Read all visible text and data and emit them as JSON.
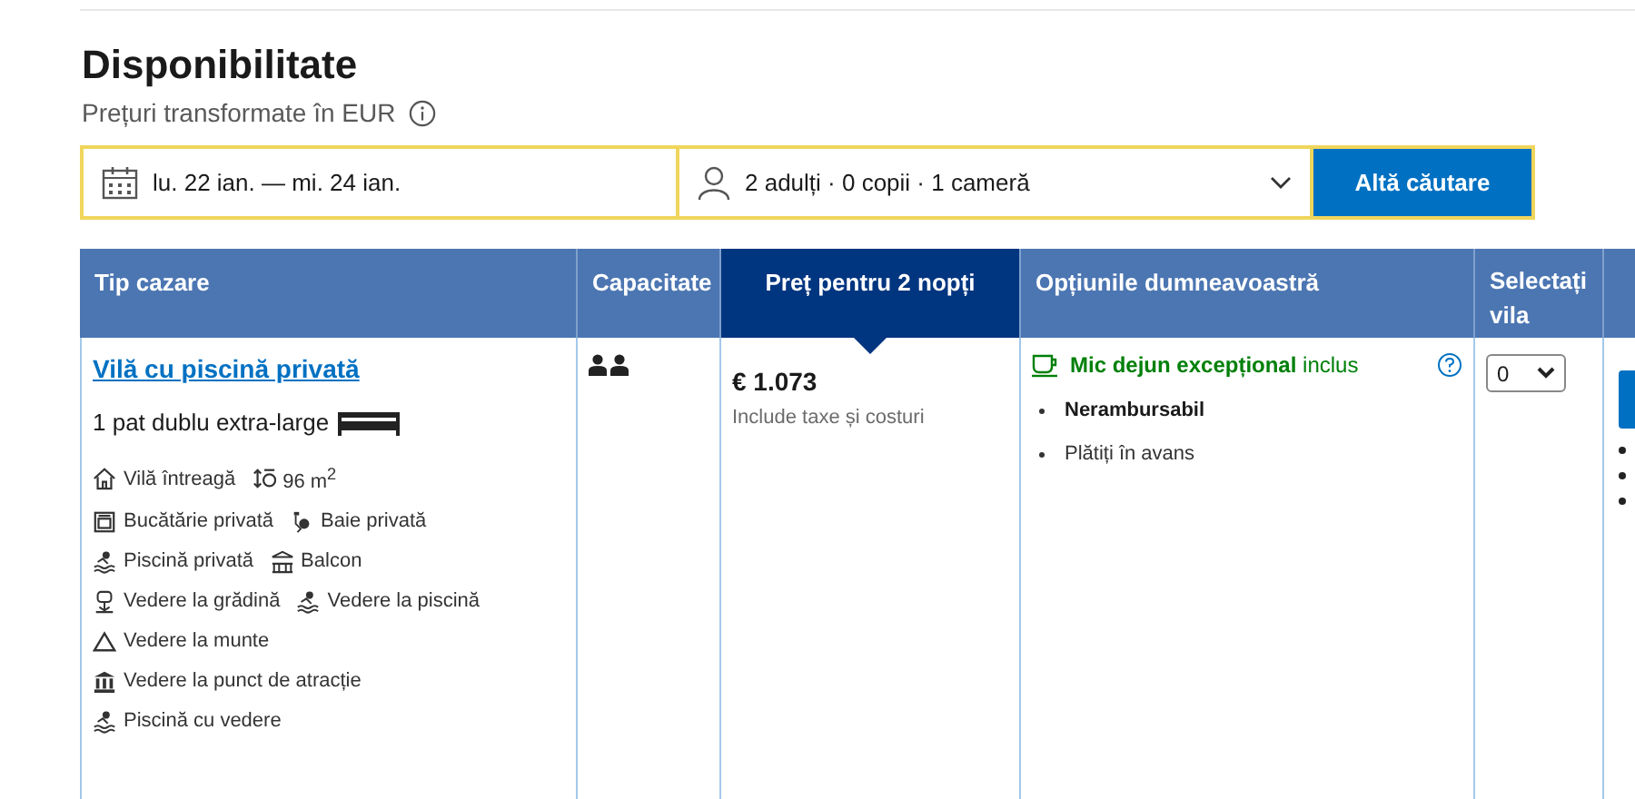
{
  "title": "Disponibilitate",
  "subtitle": "Prețuri transformate în EUR",
  "search": {
    "dates": "lu. 22 ian.  —  mi. 24 ian.",
    "guests": "2 adulți · 0 copii · 1 cameră",
    "button": "Altă căutare"
  },
  "table": {
    "columns": [
      {
        "label": "Tip cazare",
        "selected": false
      },
      {
        "label": "Capacitate",
        "selected": false
      },
      {
        "label": "Preț pentru 2 nopți",
        "selected": true
      },
      {
        "label": "Opțiunile dumneavoastră",
        "selected": false
      },
      {
        "label": "Selectați vila",
        "selected": false
      }
    ],
    "rows": [
      {
        "room_name": "Vilă cu piscină privată",
        "bed": "1 pat dublu extra-large",
        "facilities": [
          [
            {
              "kind": "house",
              "label": "Vilă întreagă"
            },
            {
              "kind": "area",
              "label": "96 m$^{2}$"
            }
          ],
          [
            {
              "kind": "kitchen",
              "label": "Bucătărie privată"
            },
            {
              "kind": "bath",
              "label": "Baie privată"
            }
          ],
          [
            {
              "kind": "pool",
              "label": "Piscină privată"
            },
            {
              "kind": "balcony",
              "label": "Balcon"
            }
          ],
          [
            {
              "kind": "garden",
              "label": "Vedere la grădină"
            },
            {
              "kind": "pool",
              "label": "Vedere la piscină"
            }
          ],
          [
            {
              "kind": "mountain",
              "label": "Vedere la munte"
            }
          ],
          [
            {
              "kind": "landmark",
              "label": "Vedere la punct de atracție"
            }
          ],
          [
            {
              "kind": "pool",
              "label": "Piscină cu vedere"
            }
          ]
        ],
        "price": "€ 1.073",
        "price_note": "Include taxe și costuri",
        "options": [
          {
            "kind": "meal",
            "text": "**Mic dejun excepțional** inclus"
          },
          {
            "kind": "bullet_bold",
            "text": "Nerambursabil"
          },
          {
            "kind": "bullet",
            "text": "Plătiți în avans"
          }
        ],
        "quantity": "0"
      }
    ]
  }
}
